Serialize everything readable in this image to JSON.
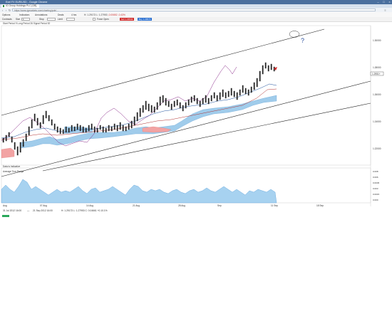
{
  "window": {
    "title": "Exel FX EUR/USD - Google Chrome",
    "controls": [
      "–",
      "□",
      "×"
    ]
  },
  "tab": {
    "label": "IG Group Holdings PLC [GB]"
  },
  "address": {
    "url": "https://www.igmarkets.com/charting/pub/..."
  },
  "toolbar": {
    "options": "Options",
    "indicators": "Indicators",
    "annotations": "Annotations",
    "deals": "Deals",
    "interval": "4 hrs",
    "ohlc_prefix": "H: 1.29173  L: 1.27953",
    "change": "-0.00652",
    "change_pct": "-0.43%"
  },
  "toolbar2": {
    "contracts": "Contracts",
    "size_label": "Size",
    "size_value": "1",
    "stop_label": "Stop",
    "limit_label": "Limit",
    "force_open": "Force Open",
    "sell": "Sell 1.29543",
    "buy": "Buy 1.29573"
  },
  "main_chart": {
    "study_label": "Start Period  9     Long Period  26     Signal Period  52",
    "price_badge": "1.2951+",
    "y_ticks": [
      "1.30000",
      "1.28000",
      "1.26000",
      "1.24000",
      "1.22000"
    ]
  },
  "sub_chart": {
    "label": "Data is Indicative",
    "indicator": "Average True Range",
    "y_ticks": [
      "0.008",
      "0.006",
      "0.0045",
      "0.003",
      "0.0015",
      "0.000"
    ]
  },
  "x_axis": {
    "ticks": [
      "Aug",
      "07 Aug",
      "14 Aug",
      "21 Aug",
      "28 Aug",
      "Sep",
      "11 Sep",
      "18 Sep"
    ]
  },
  "bottom": {
    "range_start": "31 Jul 2012 16:00",
    "range_sep": "—",
    "range_end": "21 Sep 2012 16:00",
    "ohlc": "H: 1.29173  L: 1.27953  C: 0.04661  +0.10.1%"
  },
  "colors": {
    "cloud_bull": "#8fc3e8",
    "cloud_bear": "#f2a3a3",
    "conversion_line": "#8a2a8a",
    "base_line": "#1a4f9c",
    "channel": "#111111",
    "candle_up": "#222222",
    "atr_fill": "#a7d2f0"
  }
}
